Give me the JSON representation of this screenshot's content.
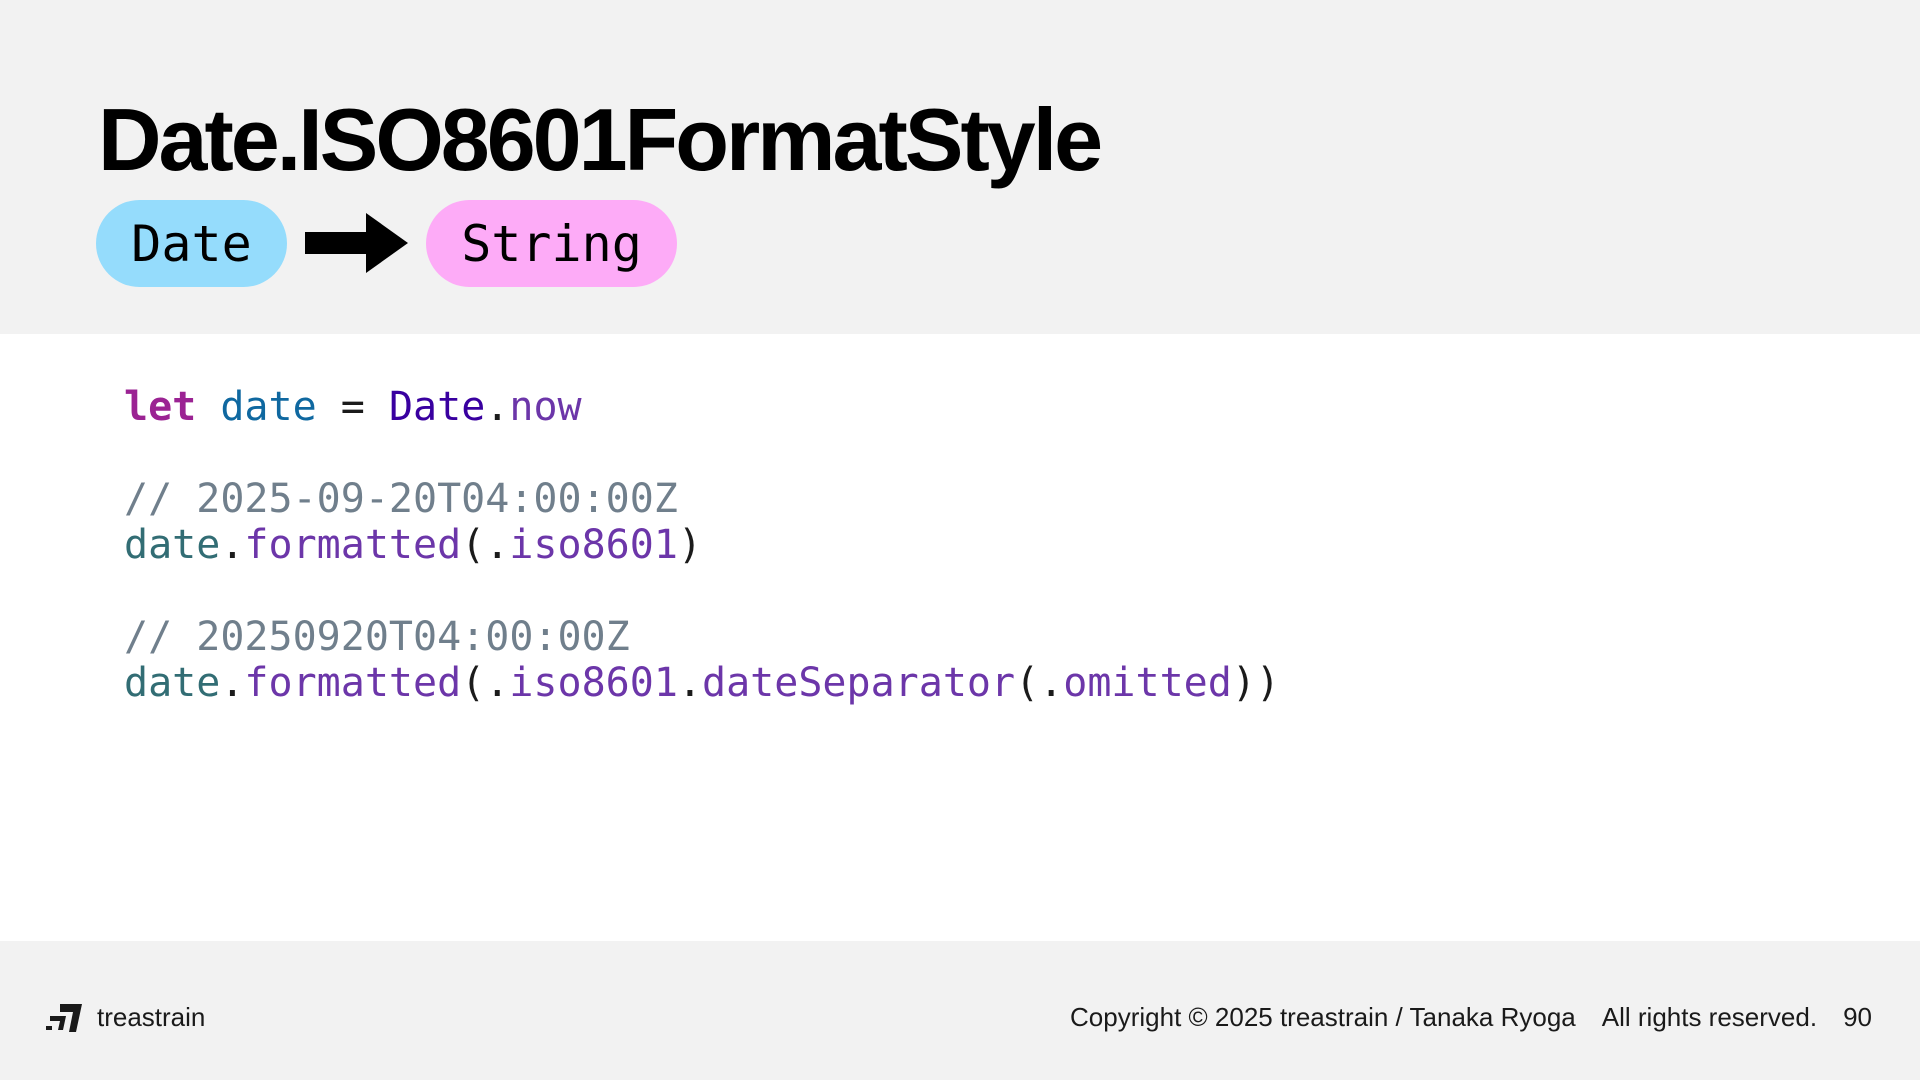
{
  "slide": {
    "title": "Date.ISO8601FormatStyle",
    "input_type": "Date",
    "output_type": "String"
  },
  "code": {
    "line1": {
      "kw": "let",
      "var": "date",
      "op": "=",
      "type": "Date",
      "dot": ".",
      "member": "now"
    },
    "comment1": "// 2025-09-20T04:00:00Z",
    "line2": {
      "ref": "date",
      "dot": ".",
      "method": "formatted",
      "open": "(.",
      "arg": "iso8601",
      "close": ")"
    },
    "comment2": "// 20250920T04:00:00Z",
    "line3": {
      "ref": "date",
      "dot": ".",
      "method": "formatted",
      "open": "(.",
      "arg": "iso8601",
      "dot2": ".",
      "method2": "dateSeparator",
      "open2": "(.",
      "arg2": "omitted",
      "close": "))"
    }
  },
  "footer": {
    "brand": "treastrain",
    "copyright": "Copyright © 2025 treastrain / Tanaka Ryoga",
    "rights": "All rights reserved.",
    "page_number": "90"
  },
  "colors": {
    "header_bg": "#f2f2f2",
    "date_pill": "#95dcfc",
    "string_pill": "#fdabf7",
    "keyword": "#9b2393",
    "comment": "#707f8c",
    "member": "#6c36a9"
  },
  "icons": {
    "arrow": "right-arrow-icon",
    "logo": "treastrain-logo-icon"
  }
}
